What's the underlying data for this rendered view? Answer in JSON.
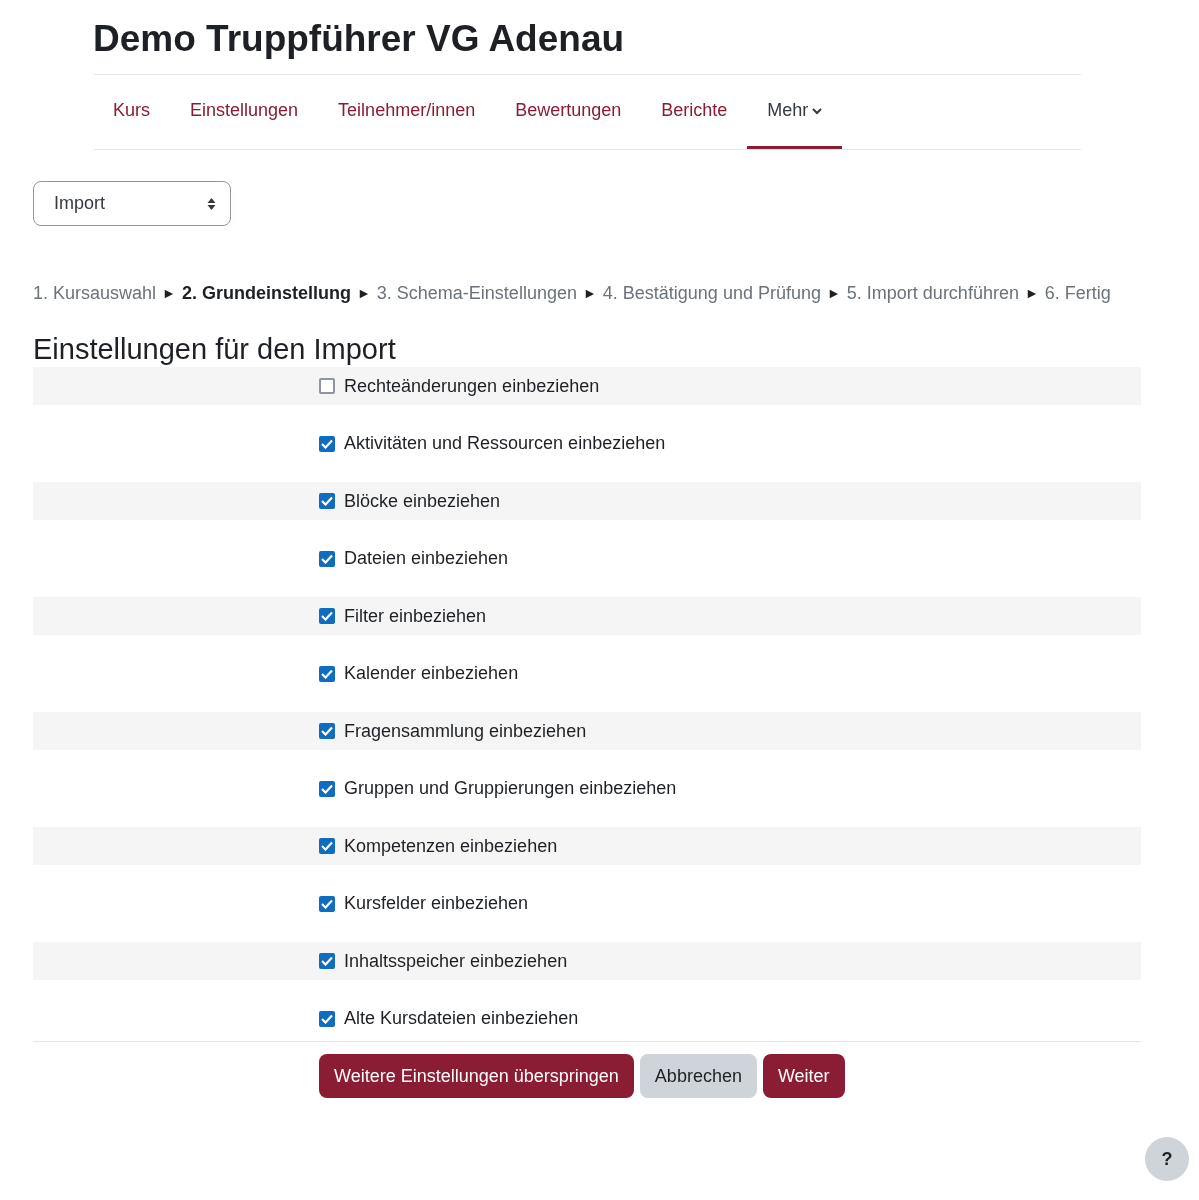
{
  "course_title": "Demo Truppführer VG Adenau",
  "nav": [
    {
      "label": "Kurs",
      "selected": false,
      "dropdown": false
    },
    {
      "label": "Einstellungen",
      "selected": false,
      "dropdown": false
    },
    {
      "label": "Teilnehmer/innen",
      "selected": false,
      "dropdown": false
    },
    {
      "label": "Bewertungen",
      "selected": false,
      "dropdown": false
    },
    {
      "label": "Berichte",
      "selected": false,
      "dropdown": false
    },
    {
      "label": "Mehr",
      "selected": true,
      "dropdown": true
    }
  ],
  "action_select": {
    "value": "Import"
  },
  "steps": [
    {
      "label": "1. Kursauswahl",
      "selected": false
    },
    {
      "label": "2. Grundeinstellung",
      "selected": true
    },
    {
      "label": "3. Schema-Einstellungen",
      "selected": false
    },
    {
      "label": "4. Bestätigung und Prüfung",
      "selected": false
    },
    {
      "label": "5. Import durchführen",
      "selected": false
    },
    {
      "label": "6. Fertig",
      "selected": false
    }
  ],
  "step_separator": "►",
  "section_heading": "Einstellungen für den Import",
  "options": [
    {
      "label": "Rechteänderungen einbeziehen",
      "checked": false
    },
    {
      "label": "Aktivitäten und Ressourcen einbeziehen",
      "checked": true
    },
    {
      "label": "Blöcke einbeziehen",
      "checked": true
    },
    {
      "label": "Dateien einbeziehen",
      "checked": true
    },
    {
      "label": "Filter einbeziehen",
      "checked": true
    },
    {
      "label": "Kalender einbeziehen",
      "checked": true
    },
    {
      "label": "Fragensammlung einbeziehen",
      "checked": true
    },
    {
      "label": "Gruppen und Gruppierungen einbeziehen",
      "checked": true
    },
    {
      "label": "Kompetenzen einbeziehen",
      "checked": true
    },
    {
      "label": "Kursfelder einbeziehen",
      "checked": true
    },
    {
      "label": "Inhaltsspeicher einbeziehen",
      "checked": true
    },
    {
      "label": "Alte Kursdateien einbeziehen",
      "checked": true
    }
  ],
  "buttons": [
    {
      "label": "Weitere Einstellungen überspringen",
      "kind": "primary"
    },
    {
      "label": "Abbrechen",
      "kind": "secondary"
    },
    {
      "label": "Weiter",
      "kind": "primary"
    }
  ],
  "help_button": {
    "label": "?"
  }
}
